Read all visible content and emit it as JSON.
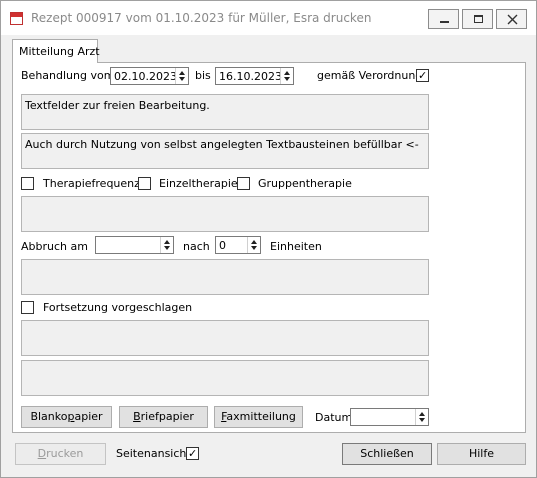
{
  "window": {
    "title": "Rezept 000917 vom 01.10.2023 für Müller, Esra drucken"
  },
  "tab": {
    "label": "Mitteilung Arzt"
  },
  "behandlung": {
    "label_vom": "Behandlung vom",
    "from_date": "02.10.2023",
    "label_bis": "bis",
    "to_date": "16.10.2023",
    "verordnung_label": "gemäß Verordnung",
    "verordnung_checked": "✓"
  },
  "textfield1": "Textfelder zur freien Bearbeitung.",
  "textfield2": "Auch durch Nutzung von selbst angelegten Textbausteinen befüllbar <-",
  "checks": {
    "therapiefrequenz": "Therapiefrequenz",
    "einzeltherapie": "Einzeltherapie",
    "gruppentherapie": "Gruppentherapie"
  },
  "abbruch": {
    "label_am": "Abbruch am",
    "am_value": "",
    "label_nach": "nach",
    "nach_value": "0",
    "label_einheiten": "Einheiten"
  },
  "fortsetzung": {
    "label": "Fortsetzung vorgeschlagen"
  },
  "buttons": {
    "blankopapier_pre": "Blanko",
    "blankopapier_acc": "p",
    "blankopapier_post": "apier",
    "briefpapier_acc": "B",
    "briefpapier_post": "riefpapier",
    "faxmitteilung_acc": "F",
    "faxmitteilung_post": "axmitteilung",
    "datum_label": "Datum",
    "datum_value": ""
  },
  "footer": {
    "drucken_acc": "D",
    "drucken_post": "rucken",
    "seitenansicht_label": "Seitenansicht",
    "seitenansicht_checked": "✓",
    "schliessen": "Schließen",
    "hilfe": "Hilfe"
  }
}
